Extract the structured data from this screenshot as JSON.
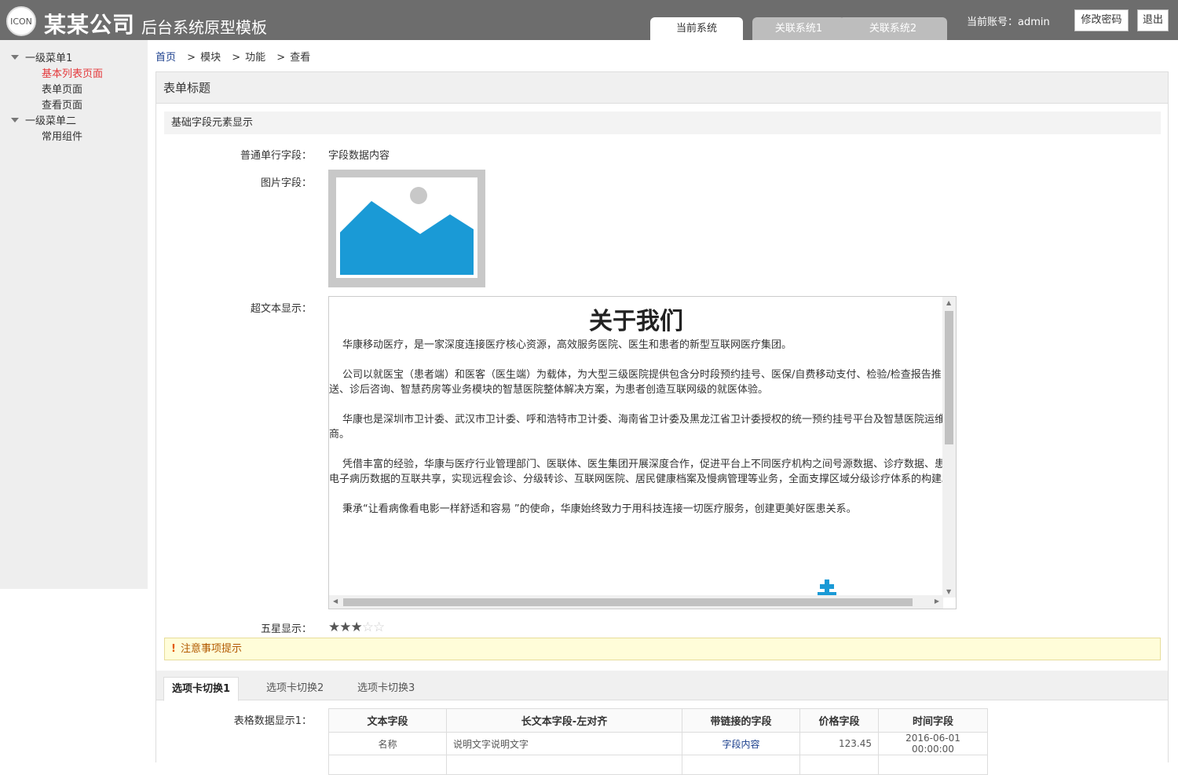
{
  "header": {
    "logo_text": "ICON",
    "company": "某某公司",
    "system_title": "后台系统原型模板",
    "tabs": [
      {
        "label": "当前系统",
        "active": true
      },
      {
        "label": "关联系统1",
        "active": false
      },
      {
        "label": "关联系统2",
        "active": false
      }
    ],
    "account": "当前账号：admin",
    "change_password": "修改密码",
    "logout": "退出"
  },
  "sidebar": {
    "groups": [
      {
        "label": "一级菜单1",
        "items": [
          {
            "label": "基本列表页面",
            "active": true
          },
          {
            "label": "表单页面",
            "active": false
          },
          {
            "label": "查看页面",
            "active": false
          }
        ]
      },
      {
        "label": "一级菜单二",
        "items": [
          {
            "label": "常用组件",
            "active": false
          }
        ]
      }
    ]
  },
  "breadcrumb": {
    "home": "首页",
    "items": [
      "模块",
      "功能",
      "查看"
    ],
    "sep": ">"
  },
  "form": {
    "title": "表单标题",
    "section": "基础字段元素显示",
    "text_field_label": "普通单行字段：",
    "text_field_value": "字段数据内容",
    "image_field_label": "图片字段：",
    "rich_label": "超文本显示：",
    "rich_title": "关于我们",
    "rich_paragraphs": [
      "华康移动医疗，是一家深度连接医疗核心资源，高效服务医院、医生和患者的新型互联网医疗集团。",
      "公司以就医宝（患者端）和医客（医生端）为载体，为大型三级医院提供包含分时段预约挂号、医保/自费移动支付、检验/检查报告推送、诊后咨询、智慧药房等业务模块的智慧医院整体解决方案，为患者创造互联网级的就医体验。",
      "华康也是深圳市卫计委、武汉市卫计委、呼和浩特市卫计委、海南省卫计委及黑龙江省卫计委授权的统一预约挂号平台及智慧医院运维商。",
      "凭借丰富的经验，华康与医疗行业管理部门、医联体、医生集团开展深度合作，促进平台上不同医疗机构之间号源数据、诊疗数据、患者电子病历数据的互联共享，实现远程会诊、分级转诊、互联网医院、居民健康档案及慢病管理等业务，全面支撑区域分级诊疗体系的构建。",
      "秉承“让看病像看电影一样舒适和容易 ”的使命，华康始终致力于用科技连接一切医疗服务，创建更美好医患关系。"
    ],
    "stars_label": "五星显示：",
    "stars_value": 3,
    "stars_max": 5,
    "notice_icon": "!",
    "notice": "注意事项提示"
  },
  "tabs": [
    {
      "label": "选项卡切换1",
      "active": true
    },
    {
      "label": "选项卡切换2",
      "active": false
    },
    {
      "label": "选项卡切换3",
      "active": false
    }
  ],
  "table": {
    "label": "表格数据显示1：",
    "headers": [
      "文本字段",
      "长文本字段-左对齐",
      "带链接的字段",
      "价格字段",
      "时间字段"
    ],
    "rows": [
      [
        "名称",
        "说明文字说明文字",
        "字段内容",
        "123.45",
        "2016-06-01 00:00:00"
      ]
    ]
  },
  "colors": {
    "header_bg": "#6d6d6d",
    "accent_red": "#e4393c",
    "link_blue": "#1a3e8c",
    "image_blue": "#1a9ad6"
  }
}
